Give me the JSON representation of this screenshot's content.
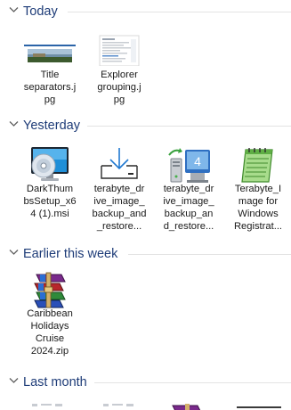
{
  "groups": [
    {
      "title": "Today",
      "items": [
        {
          "name": "Title separators.jpg",
          "lines": [
            "Title",
            "separators.j",
            "pg"
          ]
        },
        {
          "name": "Explorer grouping.jpg",
          "lines": [
            "Explorer",
            "grouping.j",
            "pg"
          ]
        }
      ]
    },
    {
      "title": "Yesterday",
      "items": [
        {
          "name": "DarkThumbsSetup_x64 (1).msi",
          "lines": [
            "DarkThum",
            "bsSetup_x6",
            "4 (1).msi"
          ]
        },
        {
          "name": "terabyte_drive_image_backup_and_restore",
          "lines": [
            "terabyte_dr",
            "ive_image_",
            "backup_and",
            "_restore..."
          ]
        },
        {
          "name": "terabyte_drive_image_backup_and_restore",
          "lines": [
            "terabyte_dr",
            "ive_image_",
            "backup_an",
            "d_restore..."
          ]
        },
        {
          "name": "Terabyte_Image for Windows Registration",
          "lines": [
            "Terabyte_I",
            "mage for",
            "Windows",
            "Registrat..."
          ]
        }
      ]
    },
    {
      "title": "Earlier this week",
      "items": [
        {
          "name": "Caribbean Holidays Cruise 2024.zip",
          "lines": [
            "Caribbean",
            "Holidays",
            "Cruise",
            "2024.zip"
          ]
        }
      ]
    },
    {
      "title": "Last month",
      "items": []
    }
  ],
  "icons": {
    "title_separators": "image-thumbnail-icon",
    "explorer_grouping": "image-thumbnail-icon",
    "dark_thumbs": "msi-installer-icon",
    "terabyte_1": "download-tray-icon",
    "terabyte_2": "setup-computer-icon",
    "terabyte_3": "registration-notepad-icon",
    "caribbean": "winrar-archive-icon"
  },
  "colors": {
    "header_text": "#1e3c78",
    "divider": "#e3e3e3",
    "accent_blue": "#1f8fd8"
  }
}
